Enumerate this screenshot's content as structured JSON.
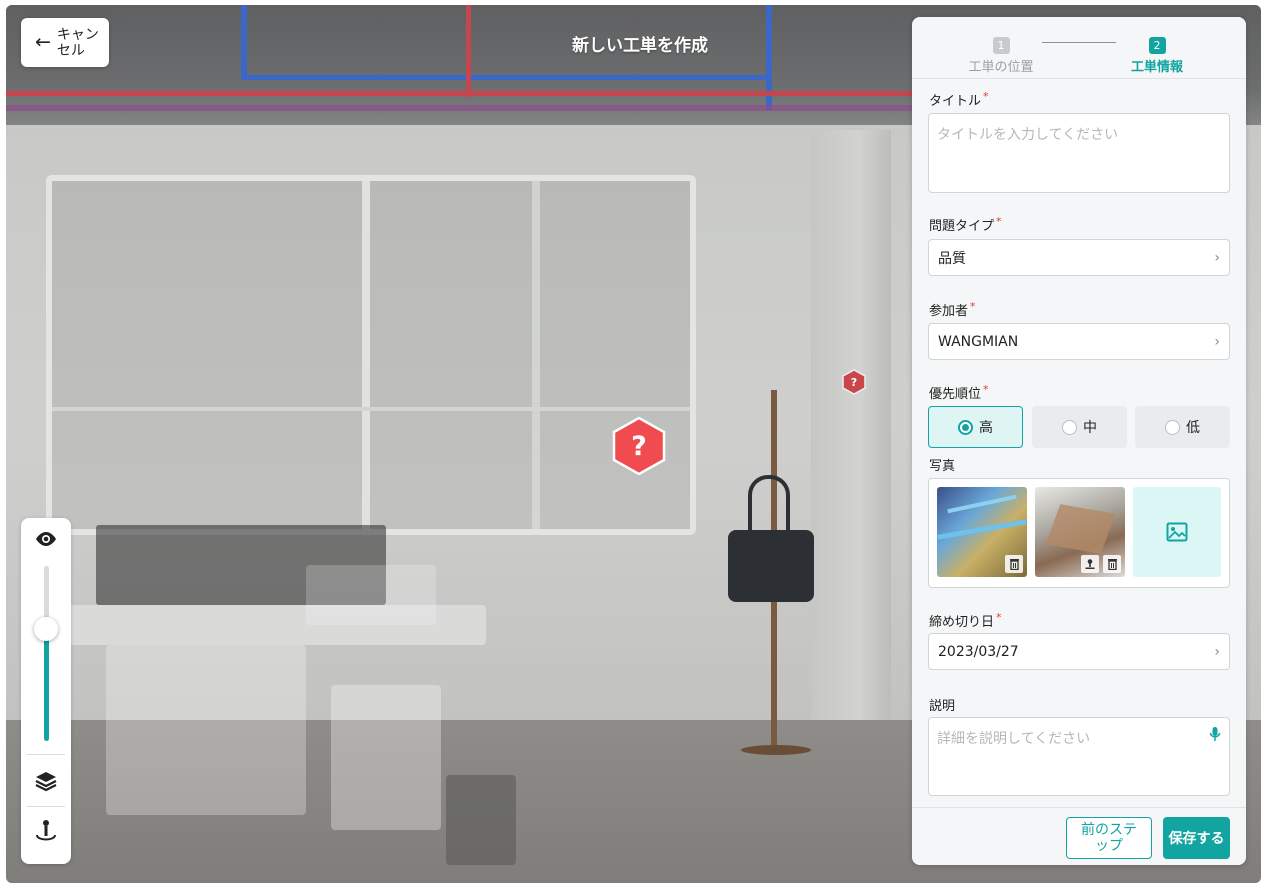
{
  "header": {
    "cancel_label": "キャンセル",
    "title": "新しい工単を作成"
  },
  "stepper": {
    "steps": [
      {
        "num": "1",
        "label": "工単の位置",
        "state": "done"
      },
      {
        "num": "2",
        "label": "工単情報",
        "state": "active"
      }
    ]
  },
  "form": {
    "title": {
      "label": "タイトル",
      "required": "*",
      "placeholder": "タイトルを入力してください"
    },
    "issue_type": {
      "label": "問題タイプ",
      "required": "*",
      "value": "品質"
    },
    "participants": {
      "label": "参加者",
      "required": "*",
      "value": "WANGMIAN"
    },
    "priority": {
      "label": "優先順位",
      "required": "*",
      "options": [
        {
          "label": "高",
          "selected": true
        },
        {
          "label": "中",
          "selected": false
        },
        {
          "label": "低",
          "selected": false
        }
      ]
    },
    "photos": {
      "label": "写真"
    },
    "deadline": {
      "label": "締め切り日",
      "required": "*",
      "value": "2023/03/27"
    },
    "description": {
      "label": "説明",
      "placeholder": "詳細を説明してください"
    }
  },
  "footer": {
    "prev_label": "前のステップ",
    "save_label": "保存する"
  },
  "tools": {
    "opacity_level": 0.64
  },
  "colors": {
    "accent": "#12a4a0",
    "required": "#e53935",
    "marker": "#f04b4f"
  },
  "icons": [
    "arrow-left-icon",
    "eye-icon",
    "layers-icon",
    "person-pin-icon",
    "question-marker-icon",
    "chevron-right-icon",
    "trash-icon",
    "image-icon",
    "microphone-icon",
    "pin-icon"
  ]
}
